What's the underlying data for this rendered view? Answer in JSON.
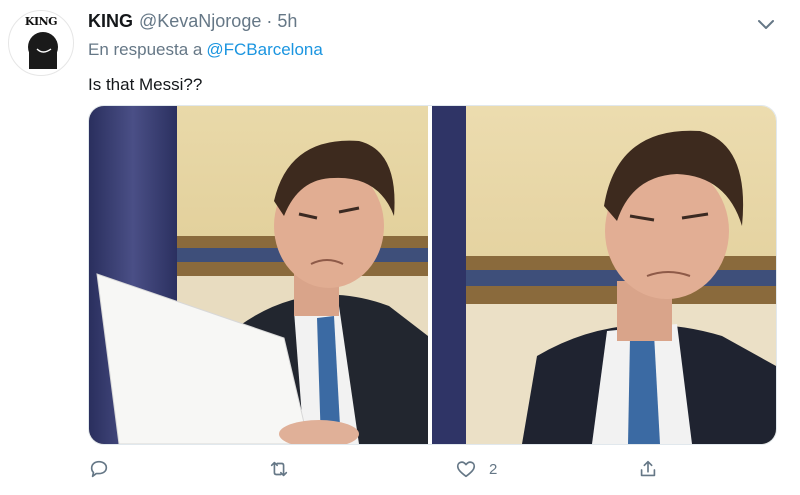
{
  "tweet": {
    "avatar_text": "KING",
    "name": "KING",
    "handle": "@KevaNjoroge",
    "separator": "·",
    "time": "5h",
    "reply_prefix": "En respuesta a",
    "reply_to": "@FCBarcelona",
    "text": "Is that Messi??",
    "media": [
      {
        "icon": "photo-left-reading-paper"
      },
      {
        "icon": "photo-right-squinting"
      }
    ],
    "actions": {
      "reply": {
        "icon": "reply-icon"
      },
      "retweet": {
        "icon": "retweet-icon"
      },
      "like": {
        "icon": "heart-icon",
        "count": "2"
      },
      "share": {
        "icon": "share-icon"
      }
    }
  },
  "colors": {
    "link": "#1b95e0",
    "secondary_text": "#657786",
    "primary_text": "#14171a"
  }
}
